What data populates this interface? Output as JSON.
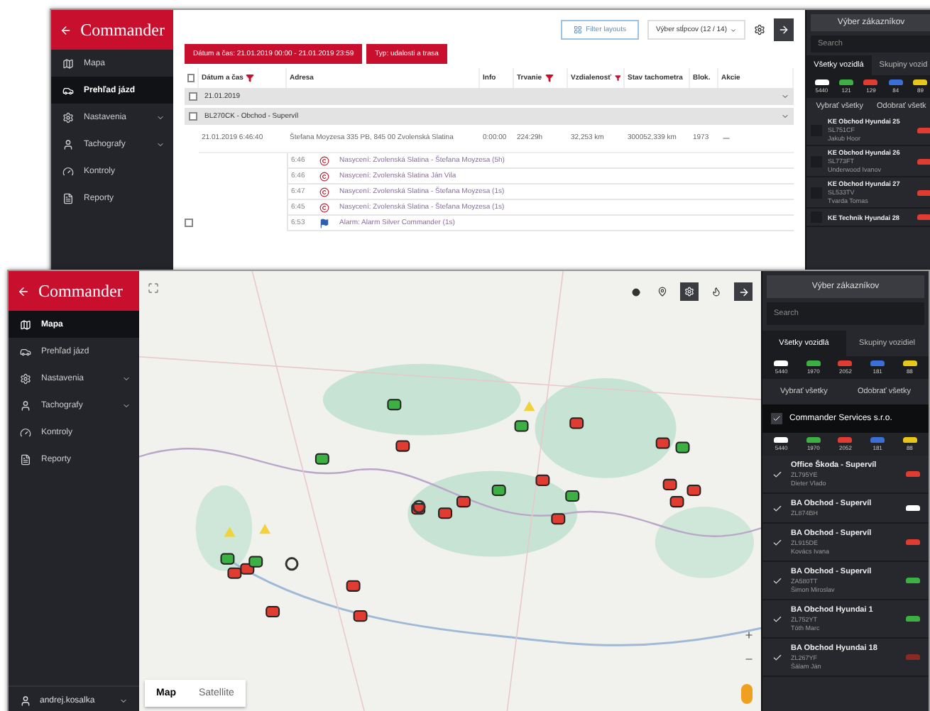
{
  "back_window": {
    "logo": "Commander",
    "sidebar": [
      {
        "label": "Mapa",
        "selected": false,
        "expandable": false
      },
      {
        "label": "Prehľad jázd",
        "selected": true,
        "expandable": false
      },
      {
        "label": "Nastavenia",
        "selected": false,
        "expandable": true
      },
      {
        "label": "Tachografy",
        "selected": false,
        "expandable": true
      },
      {
        "label": "Kontroly",
        "selected": false,
        "expandable": false
      },
      {
        "label": "Reporty",
        "selected": false,
        "expandable": false
      }
    ],
    "layouts_button": "Filter layouts",
    "column_select": "Výber stĺpcov (12 / 14)",
    "filters": [
      "Dátum a čas: 21.01.2019 00:00 - 21.01.2019 23:59",
      "Typ: udalosti a trasa"
    ],
    "table": {
      "header_checked": false,
      "columns": [
        {
          "label": "Dátum a čas",
          "filter": true
        },
        {
          "label": "Adresa",
          "filter": false
        },
        {
          "label": "Info",
          "filter": false
        },
        {
          "label": "Trvanie",
          "filter": true
        },
        {
          "label": "Vzdialenosť",
          "filter": true
        },
        {
          "label": "Stav tachometra",
          "filter": false
        },
        {
          "label": "Blok.",
          "filter": false
        },
        {
          "label": "Akcie",
          "filter": false
        }
      ],
      "groups": [
        {
          "label": "21.01.2019",
          "checked": false
        },
        {
          "label": "BL270CK - Obchod - Supervíl",
          "checked": false
        }
      ],
      "trip": {
        "checked": false,
        "time": "21.01.2019 6:46:40",
        "address": "Štefana Moyzesa 335 PB, 845 00 Zvolenská Slatina",
        "info": "0:00:00",
        "duration": "224:29h",
        "distance": "32,253 km",
        "tachometer": "300052,339 km",
        "block": "1973"
      },
      "events": [
        {
          "time": "6:46",
          "kind": "arrival",
          "text": "Nasycení: Zvolenská Slatina - Štefana Moyzesa (5h)"
        },
        {
          "time": "6:46",
          "kind": "arrival",
          "text": "Nasycení: Zvolenská Slatina Ján Vila"
        },
        {
          "time": "6:47",
          "kind": "arrival",
          "text": "Nasycení: Zvolenská Slatina - Štefana Moyzesa (1s)"
        },
        {
          "time": "6:45",
          "kind": "arrival",
          "text": "Nasycení: Zvolenská Slatina - Štefana Moyzesa (1s)"
        },
        {
          "time": "6:53",
          "kind": "message",
          "text": "Alarm: Alarm Silver Commander (1s)"
        }
      ]
    },
    "panel": {
      "title": "Výber zákazníkov",
      "search_placeholder": "Search",
      "tabs": [
        {
          "label": "Všetky vozidlá",
          "selected": true
        },
        {
          "label": "Skupiny vozid",
          "selected": false
        }
      ],
      "swatches": [
        {
          "color": "#ffffff",
          "count": "5440"
        },
        {
          "color": "#3cb043",
          "count": "121"
        },
        {
          "color": "#e03c31",
          "count": "129"
        },
        {
          "color": "#3a6fd8",
          "count": "84"
        },
        {
          "color": "#e6c619",
          "count": "89"
        }
      ],
      "actions": [
        "Vybrať všetky",
        "Odobrať všetk"
      ],
      "vehicles": [
        {
          "name": "KE Obchod Hyundai 25",
          "plate": "SL751CF",
          "driver": "Jakub Hoor",
          "checked": false,
          "color": "#e03c31"
        },
        {
          "name": "KE Obchod Hyundai 26",
          "plate": "SL773FT",
          "driver": "Underwood Ivanov",
          "checked": false,
          "color": "#e03c31"
        },
        {
          "name": "KE Obchod Hyundai 27",
          "plate": "SL533TV",
          "driver": "Tvarda Tomas",
          "checked": false,
          "color": "#e03c31"
        },
        {
          "name": "KE Technik Hyundai 28",
          "checked": false,
          "color": "#e03c31"
        }
      ]
    }
  },
  "front_window": {
    "logo": "Commander",
    "sidebar": [
      {
        "label": "Mapa",
        "selected": true,
        "expandable": false
      },
      {
        "label": "Prehľad jázd",
        "selected": false,
        "expandable": false
      },
      {
        "label": "Nastavenia",
        "selected": false,
        "expandable": true
      },
      {
        "label": "Tachografy",
        "selected": false,
        "expandable": true
      },
      {
        "label": "Kontroly",
        "selected": false,
        "expandable": false
      },
      {
        "label": "Reporty",
        "selected": false,
        "expandable": false
      }
    ],
    "user": "andrej.kosalka",
    "map_types": [
      {
        "label": "Map",
        "selected": true
      },
      {
        "label": "Satellite",
        "selected": false
      }
    ],
    "panel": {
      "title": "Výber zákazníkov",
      "search_placeholder": "Search",
      "tabs": [
        {
          "label": "Všetky vozidlá",
          "selected": true
        },
        {
          "label": "Skupiny vozidiel",
          "selected": false
        }
      ],
      "swatches": [
        {
          "color": "#ffffff",
          "count": "5440"
        },
        {
          "color": "#3cb043",
          "count": "1970"
        },
        {
          "color": "#e03c31",
          "count": "2052"
        },
        {
          "color": "#3a6fd8",
          "count": "181"
        },
        {
          "color": "#e6c619",
          "count": "88"
        }
      ],
      "actions": [
        "Vybrať všetky",
        "Odobrať všetky"
      ],
      "company": {
        "name": "Commander Services s.r.o.",
        "checked": true
      },
      "company_swatches": [
        {
          "color": "#ffffff",
          "count": "5440"
        },
        {
          "color": "#3cb043",
          "count": "1970"
        },
        {
          "color": "#e03c31",
          "count": "2052"
        },
        {
          "color": "#3a6fd8",
          "count": "181"
        },
        {
          "color": "#e6c619",
          "count": "88"
        }
      ],
      "vehicles": [
        {
          "name": "Office Škoda - Supervíl",
          "plate": "ZL795YE",
          "driver": "Dieter Vlado",
          "checked": true,
          "color": "#e03c31"
        },
        {
          "name": "BA Obchod - Supervíl",
          "plate": "ZL874BH",
          "checked": true,
          "color": "#ffffff"
        },
        {
          "name": "BA Obchod - Supervíl",
          "plate": "ZL915DE",
          "driver": "Kovács Ivana",
          "checked": true,
          "color": "#e03c31"
        },
        {
          "name": "BA Obchod - Supervíl",
          "plate": "ZA580TT",
          "driver": "Šimon Miroslav",
          "checked": true,
          "color": "#3cb043"
        },
        {
          "name": "BA Obchod Hyundai 1",
          "plate": "ZL752YT",
          "driver": "Tóth Marc",
          "checked": true,
          "color": "#3cb043"
        },
        {
          "name": "BA Obchod Hyundai 18",
          "plate": "ZL267YF",
          "driver": "Šálam Ján",
          "checked": true,
          "color": "#8b2a22"
        }
      ]
    }
  }
}
